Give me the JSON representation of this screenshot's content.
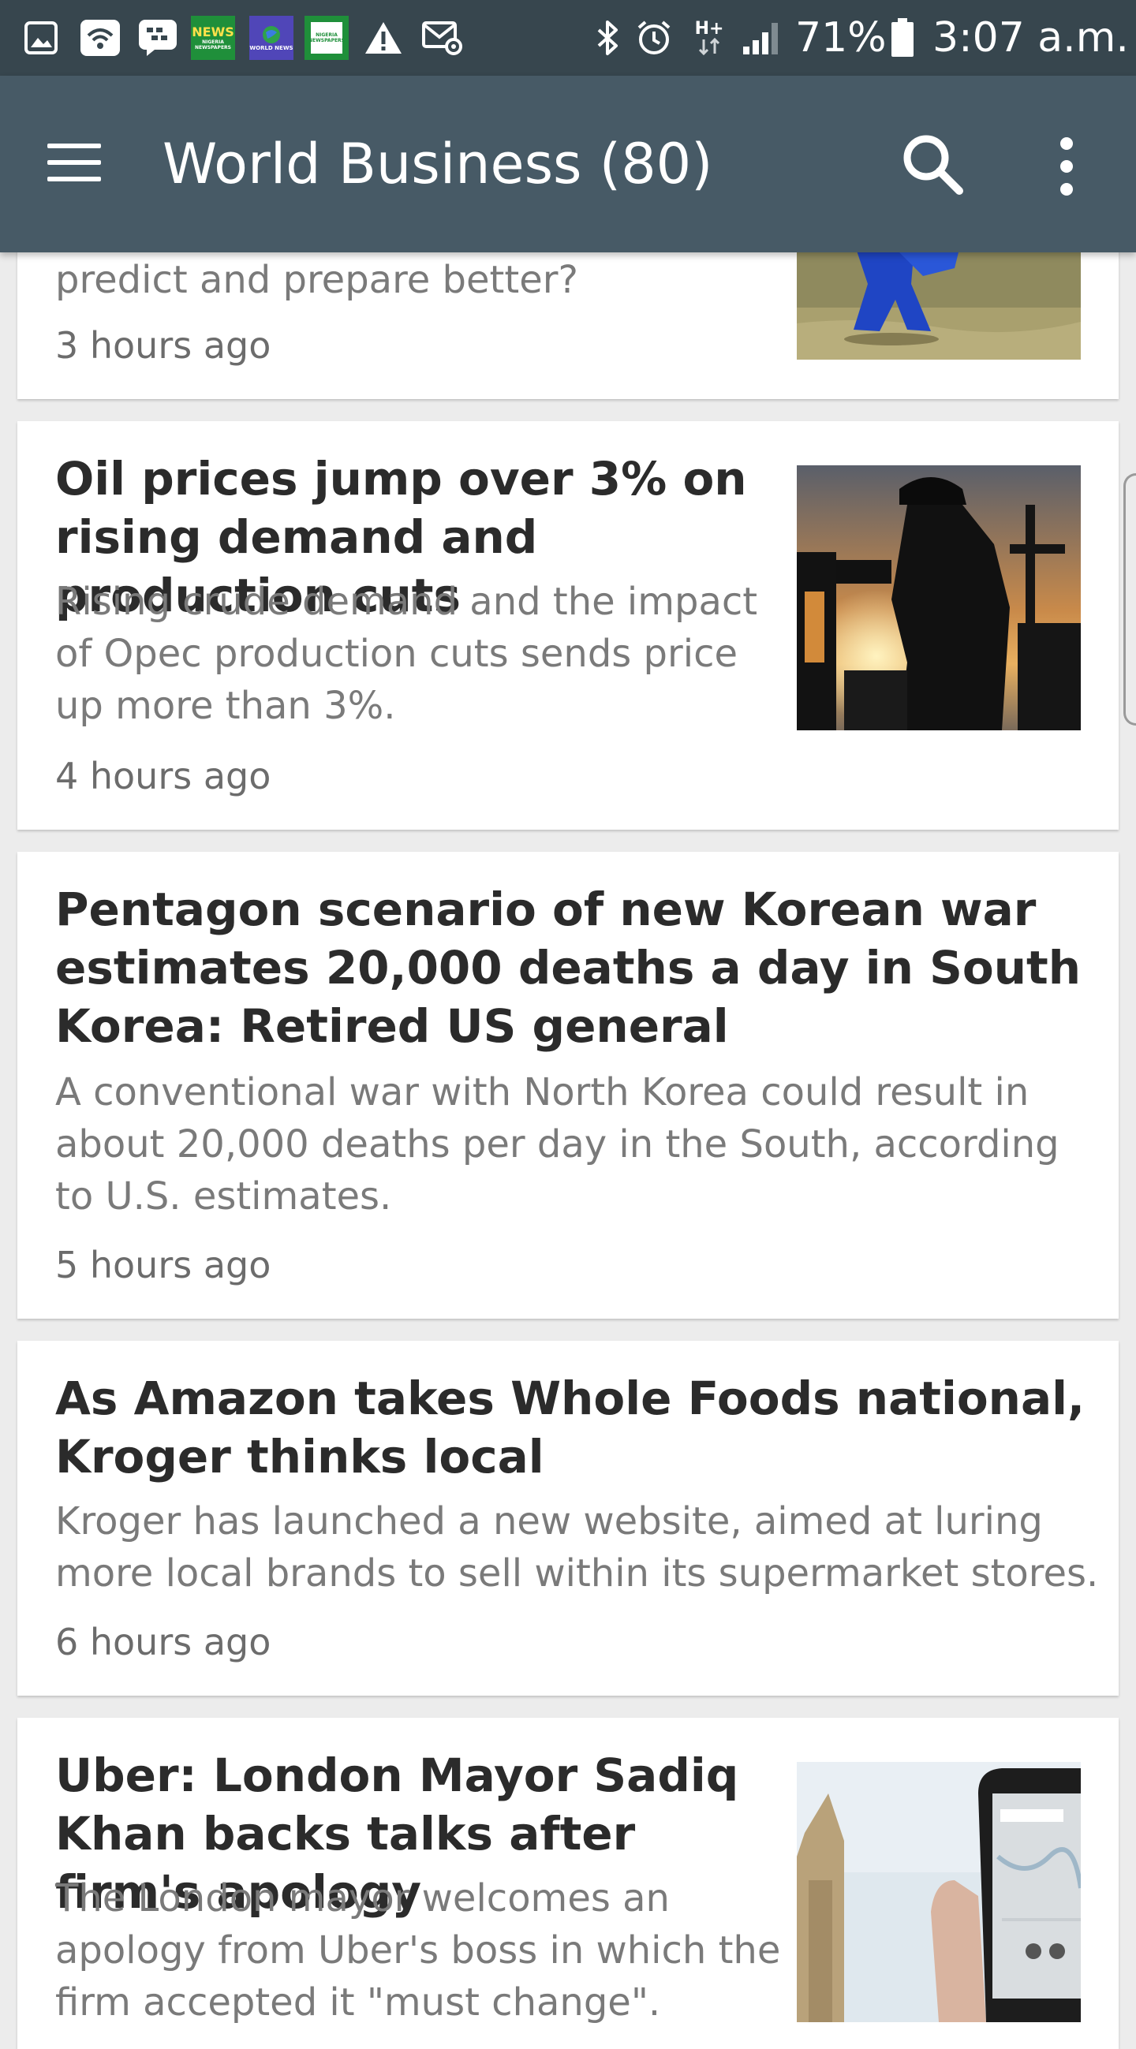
{
  "status_bar": {
    "news_tile_label": "NEWS",
    "news_tile_sub": "NIGERIA NEWSPAPERS",
    "world_tile_label": "WORLD NEWS",
    "nigeria_tile_label": "NIGERIA NEWSPAPERS",
    "network_type": "H+",
    "battery_percent": "71%",
    "time": "3:07 a.m."
  },
  "toolbar": {
    "title": "World Business (80)"
  },
  "articles": [
    {
      "title": "",
      "summary": "predict and prepare better?",
      "time": "3 hours ago"
    },
    {
      "title": "Oil prices jump over 3% on rising demand and production cuts",
      "summary": "Rising crude demand and the impact of Opec production cuts sends price up more than 3%.",
      "time": "4 hours ago"
    },
    {
      "title": "Pentagon scenario of new Korean war estimates 20,000 deaths a day in South Korea: Retired US general",
      "summary": "A conventional war with North Korea could result in about 20,000 deaths per day in the South, according to U.S. estimates.",
      "time": "5 hours ago"
    },
    {
      "title": "As Amazon takes Whole Foods national, Kroger thinks local",
      "summary": "Kroger has launched a new website, aimed at luring more local brands to sell within its supermarket stores.",
      "time": "6 hours ago"
    },
    {
      "title": "Uber: London Mayor Sadiq Khan backs talks after firm's apology",
      "summary": "The London mayor welcomes an apology from Uber's boss in which the firm accepted it \"must change\".",
      "time": ""
    }
  ],
  "colors": {
    "status_bar": "#37464e",
    "toolbar": "#475a66",
    "background": "#ececec",
    "card": "#ffffff",
    "title_text": "#2b2b2b",
    "summary_text": "#7a7a7a"
  }
}
